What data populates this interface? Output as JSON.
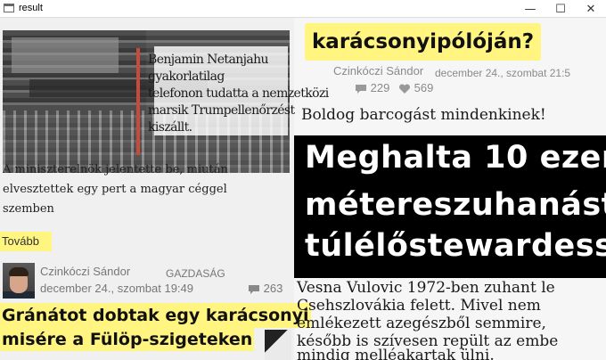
{
  "window": {
    "title": "result"
  },
  "left_article": {
    "photo_caption": "Benjamin Netanjahu gyakorlatilag\ntelefonon tudatta a nemzetközi\nmarsik Trumpellenőrzést kiszállt.",
    "lead": "A miniszterelnök jelentette be, miután\nelvesztettek egy pert a magyar céggel\nszemben",
    "more_label": "Tovább"
  },
  "second_article": {
    "author": "Czinkóczi Sándor",
    "category": "GAZDASÁG",
    "date": "december 24., szombat 19:49",
    "comments": "263",
    "headline_line1": "Gránátot dobtak egy karácsonyi",
    "headline_line2": "misére a Fülöp-szigeteken"
  },
  "right_top": {
    "headline": "karácsonyipólóján?",
    "author": "Czinkóczi Sándor",
    "date": "december 24., szombat 21:5",
    "comments": "229",
    "likes": "569",
    "teaser": "Boldog barcogást mindenkinek!"
  },
  "feature": {
    "line1": "Meghalta 10 ezer",
    "line2": "métereszuhanást",
    "line3": "túlélőstewardess",
    "body_line1": "Vesna Vulovic 1972-ben zuhant le",
    "body_line2": "Csehszlovákia felett. Mivel nem",
    "body_line3": "emlékezett azegészből semmire,",
    "body_line4": "később is szívesen repült az embe",
    "body_line5": "mindig melléakartak ülni."
  },
  "colors": {
    "highlight": "#fff580",
    "dark": "#000000",
    "meta": "#777777"
  }
}
